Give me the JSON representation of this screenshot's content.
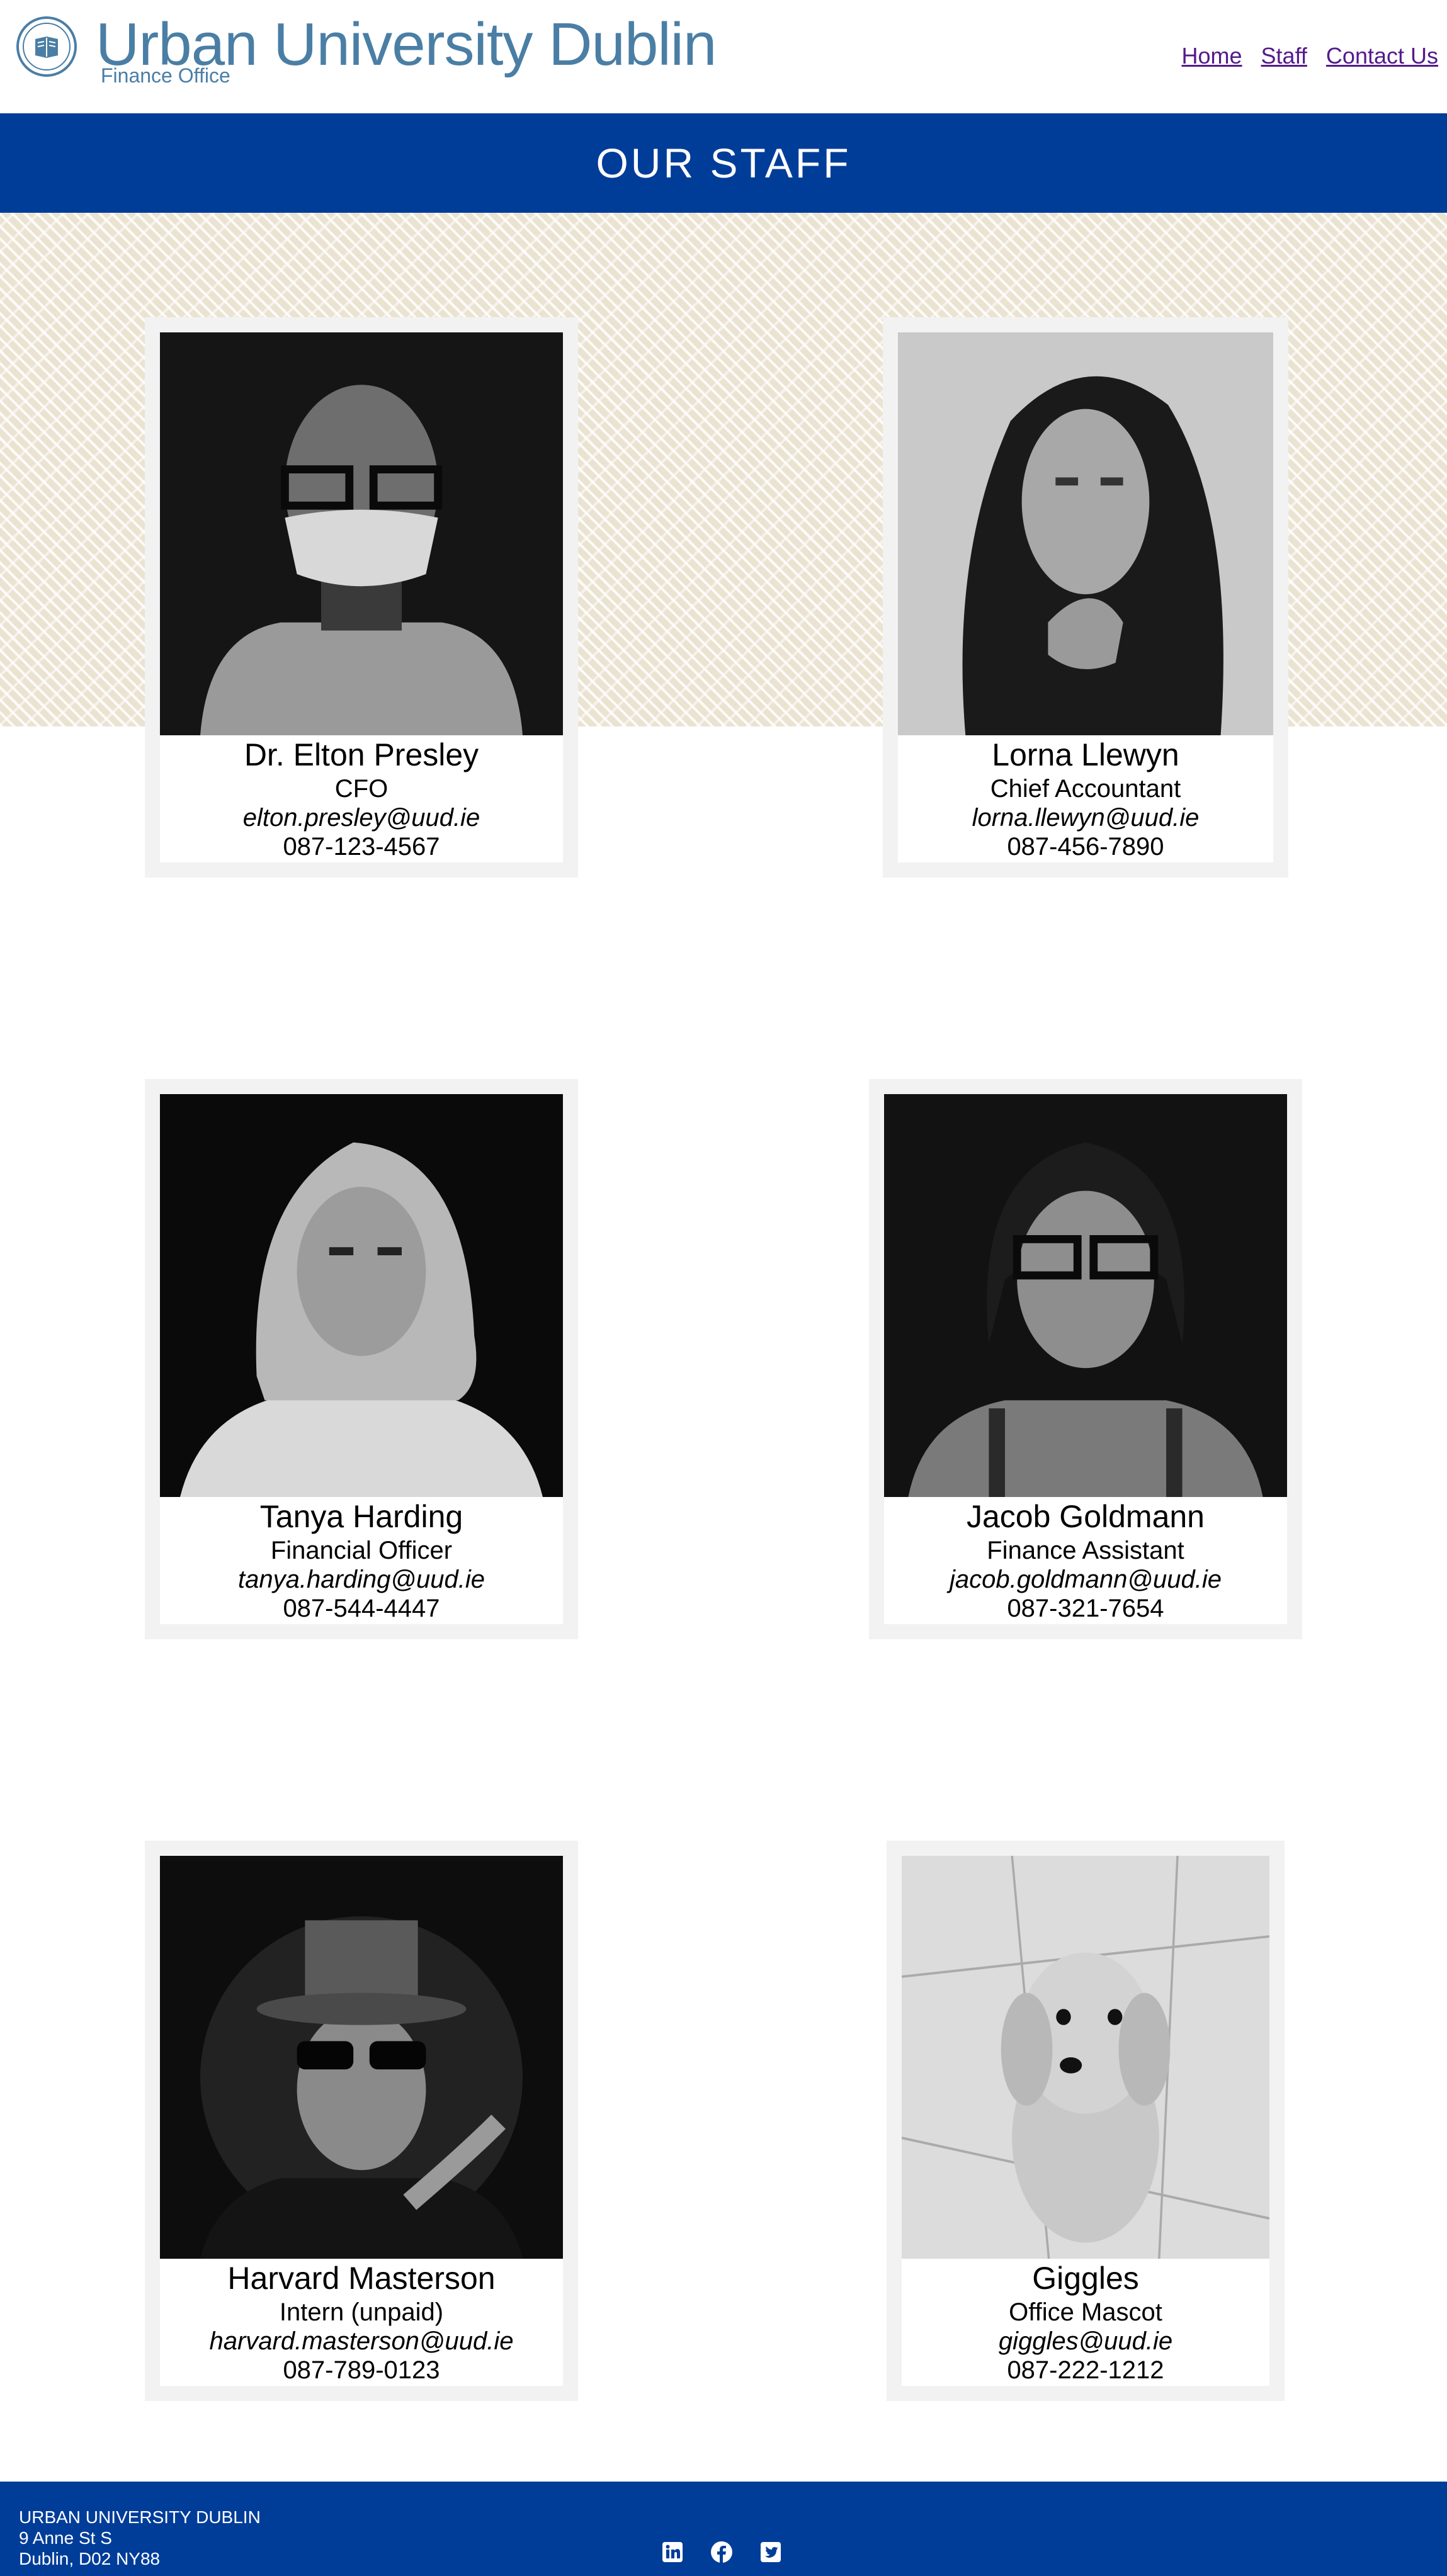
{
  "header": {
    "title": "Urban University Dublin",
    "subtitle": "Finance Office",
    "logo_icon": "university-seal-icon",
    "nav": [
      "Home",
      "Staff",
      "Contact Us"
    ]
  },
  "banner": {
    "title": "OUR STAFF"
  },
  "staff": [
    {
      "name": "Dr. Elton Presley",
      "role": "CFO",
      "email": "elton.presley@uud.ie",
      "phone": "087-123-4567",
      "photo": "man-with-glasses-and-mask-photo"
    },
    {
      "name": "Lorna Llewyn",
      "role": "Chief Accountant",
      "email": "lorna.llewyn@uud.ie",
      "phone": "087-456-7890",
      "photo": "woman-with-curly-hair-photo"
    },
    {
      "name": "Tanya Harding",
      "role": "Financial Officer",
      "email": "tanya.harding@uud.ie",
      "phone": "087-544-4447",
      "photo": "woman-with-blonde-hair-photo"
    },
    {
      "name": "Jacob Goldmann",
      "role": "Finance Assistant",
      "email": "jacob.goldmann@uud.ie",
      "phone": "087-321-7654",
      "photo": "man-with-glasses-photo"
    },
    {
      "name": "Harvard Masterson",
      "role": "Intern (unpaid)",
      "email": "harvard.masterson@uud.ie",
      "phone": "087-789-0123",
      "photo": "man-with-hat-and-sunglasses-photo"
    },
    {
      "name": "Giggles",
      "role": "Office Mascot",
      "email": "giggles@uud.ie",
      "phone": "087-222-1212",
      "photo": "puppy-photo"
    }
  ],
  "footer": {
    "address_line1": "URBAN UNIVERSITY DUBLIN",
    "address_line2": "9 Anne St S",
    "address_line3": "Dublin, D02 NY88",
    "socials": [
      "linkedin-icon",
      "facebook-icon",
      "twitter-icon"
    ]
  },
  "colors": {
    "brand": "#4a7ea5",
    "banner": "#003d99",
    "pattern": "#ebe3d2",
    "link": "#551a8b"
  }
}
